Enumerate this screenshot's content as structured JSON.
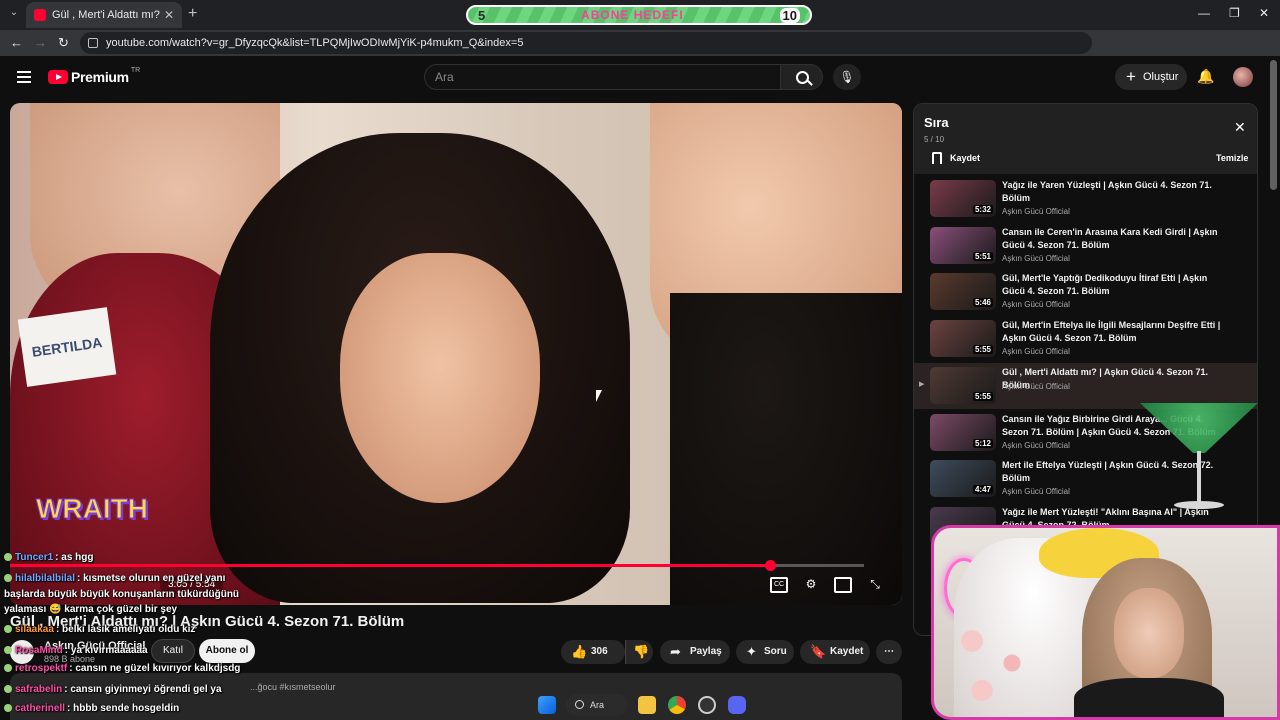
{
  "browser": {
    "tab_title": "Gül , Mert'i Aldattı mı? | Aşkın G",
    "url": "youtube.com/watch?v=gr_DfyzqcQk&list=TLPQMjIwODIwMjYiK-p4mukm_Q&index=5"
  },
  "sub_goal": {
    "start": "5",
    "label": "ABONE HEDEFI",
    "end": "10"
  },
  "header": {
    "logo_text": "Premium",
    "country": "TR",
    "search_placeholder": "Ara",
    "create_label": "Oluştur"
  },
  "video": {
    "progress": 0.89,
    "name_card": "BERTILDA",
    "watermark": "WRAITH",
    "time": "3:05 / 5:54",
    "title": "Gül , Mert'i Aldattı mı? | Aşkın Gücü 4. Sezon 71. Bölüm",
    "channel": "Aşkın Gücü Official",
    "subscribers": "898 B abone",
    "join_label": "Katıl",
    "subscribe_label": "Abone ol",
    "like_count": "306",
    "share_label": "Paylaş",
    "ask_label": "Soru",
    "save_label": "Kaydet",
    "description_snippet": "...ğocu #kısmetseolur"
  },
  "chat": [
    {
      "user": "Tuncer1",
      "msg": ": as hgg",
      "color": "#6fa8ff"
    },
    {
      "user": "hilalbilalbilal",
      "msg": ": kısmetse olurun en güzel yanı",
      "color": "#6fa8ff"
    },
    {
      "user": "",
      "msg": "başlarda büyük büyük konuşanların tükürdüğünü",
      "color": "#ffffff"
    },
    {
      "user": "",
      "msg": "yalaması 😅 karma çok güzel bir şey",
      "color": "#ffffff"
    },
    {
      "user": "silaakaa",
      "msg": ": belki lasik ameliyatı oldu kız",
      "color": "#ff9a3d"
    },
    {
      "user": "RosaMind",
      "msg": ": ya kıvırmaaaaaa",
      "color": "#ff4fa8"
    },
    {
      "user": "retrospektf",
      "msg": ": cansın ne güzel kıvırıyor kalkdjsdg",
      "color": "#ff4fa8"
    },
    {
      "user": "safrabelin",
      "msg": ": cansın giyinmeyi öğrendi gel ya",
      "color": "#ff4fa8"
    },
    {
      "user": "catherinell",
      "msg": ": hbbb sende hosgeldin",
      "color": "#ff4fa8"
    }
  ],
  "playlist": {
    "title": "Sıra",
    "count": "5 / 10",
    "save_label": "Kaydet",
    "clear_label": "Temizle",
    "items": [
      {
        "title": "Yağız ile Yaren Yüzleşti | Aşkın Gücü 4. Sezon 71. Bölüm",
        "channel": "Aşkın Gücü Official",
        "duration": "5:32",
        "color": "#7a3b4a"
      },
      {
        "title": "Cansın ile Ceren'in Arasına Kara Kedi Girdi | Aşkın Gücü 4. Sezon 71. Bölüm",
        "channel": "Aşkın Gücü Official",
        "duration": "5:51",
        "color": "#8a4f7a"
      },
      {
        "title": "Gül, Mert'le Yaptığı Dedikoduyu İtiraf Etti | Aşkın Gücü 4. Sezon 71. Bölüm",
        "channel": "Aşkın Gücü Official",
        "duration": "5:46",
        "color": "#5a3a2e"
      },
      {
        "title": "Gül, Mert'in Eftelya ile İlgili Mesajlarını Deşifre Etti | Aşkın Gücü 4. Sezon 71. Bölüm",
        "channel": "Aşkın Gücü Official",
        "duration": "5:55",
        "color": "#6b4340"
      },
      {
        "title": "Gül , Mert'i Aldattı mı? | Aşkın Gücü 4. Sezon 71. Bölüm",
        "channel": "Aşkın Gücü Official",
        "duration": "5:55",
        "color": "#4f3a34"
      },
      {
        "title": "Cansın ile Yağız Birbirine Girdi Araya... Gücü 4. Sezon 71. Bölüm | Aşkın Gücü 4. Sezon 71. Bölüm",
        "channel": "Aşkın Gücü Official",
        "duration": "5:12",
        "color": "#7c4a66"
      },
      {
        "title": "Mert ile Eftelya Yüzleşti | Aşkın Gücü 4. Sezon 72. Bölüm",
        "channel": "Aşkın Gücü Official",
        "duration": "4:47",
        "color": "#3e4c5c"
      },
      {
        "title": "Yağız ile Mert Yüzleşti! \"Aklını Başına Al\" | Aşkın Gücü 4. Sezon 72. Bölüm",
        "channel": "Aşkın Gücü Official",
        "duration": "",
        "color": "#4a3a4e"
      }
    ]
  },
  "taskbar": {
    "search_label": "Ara"
  }
}
